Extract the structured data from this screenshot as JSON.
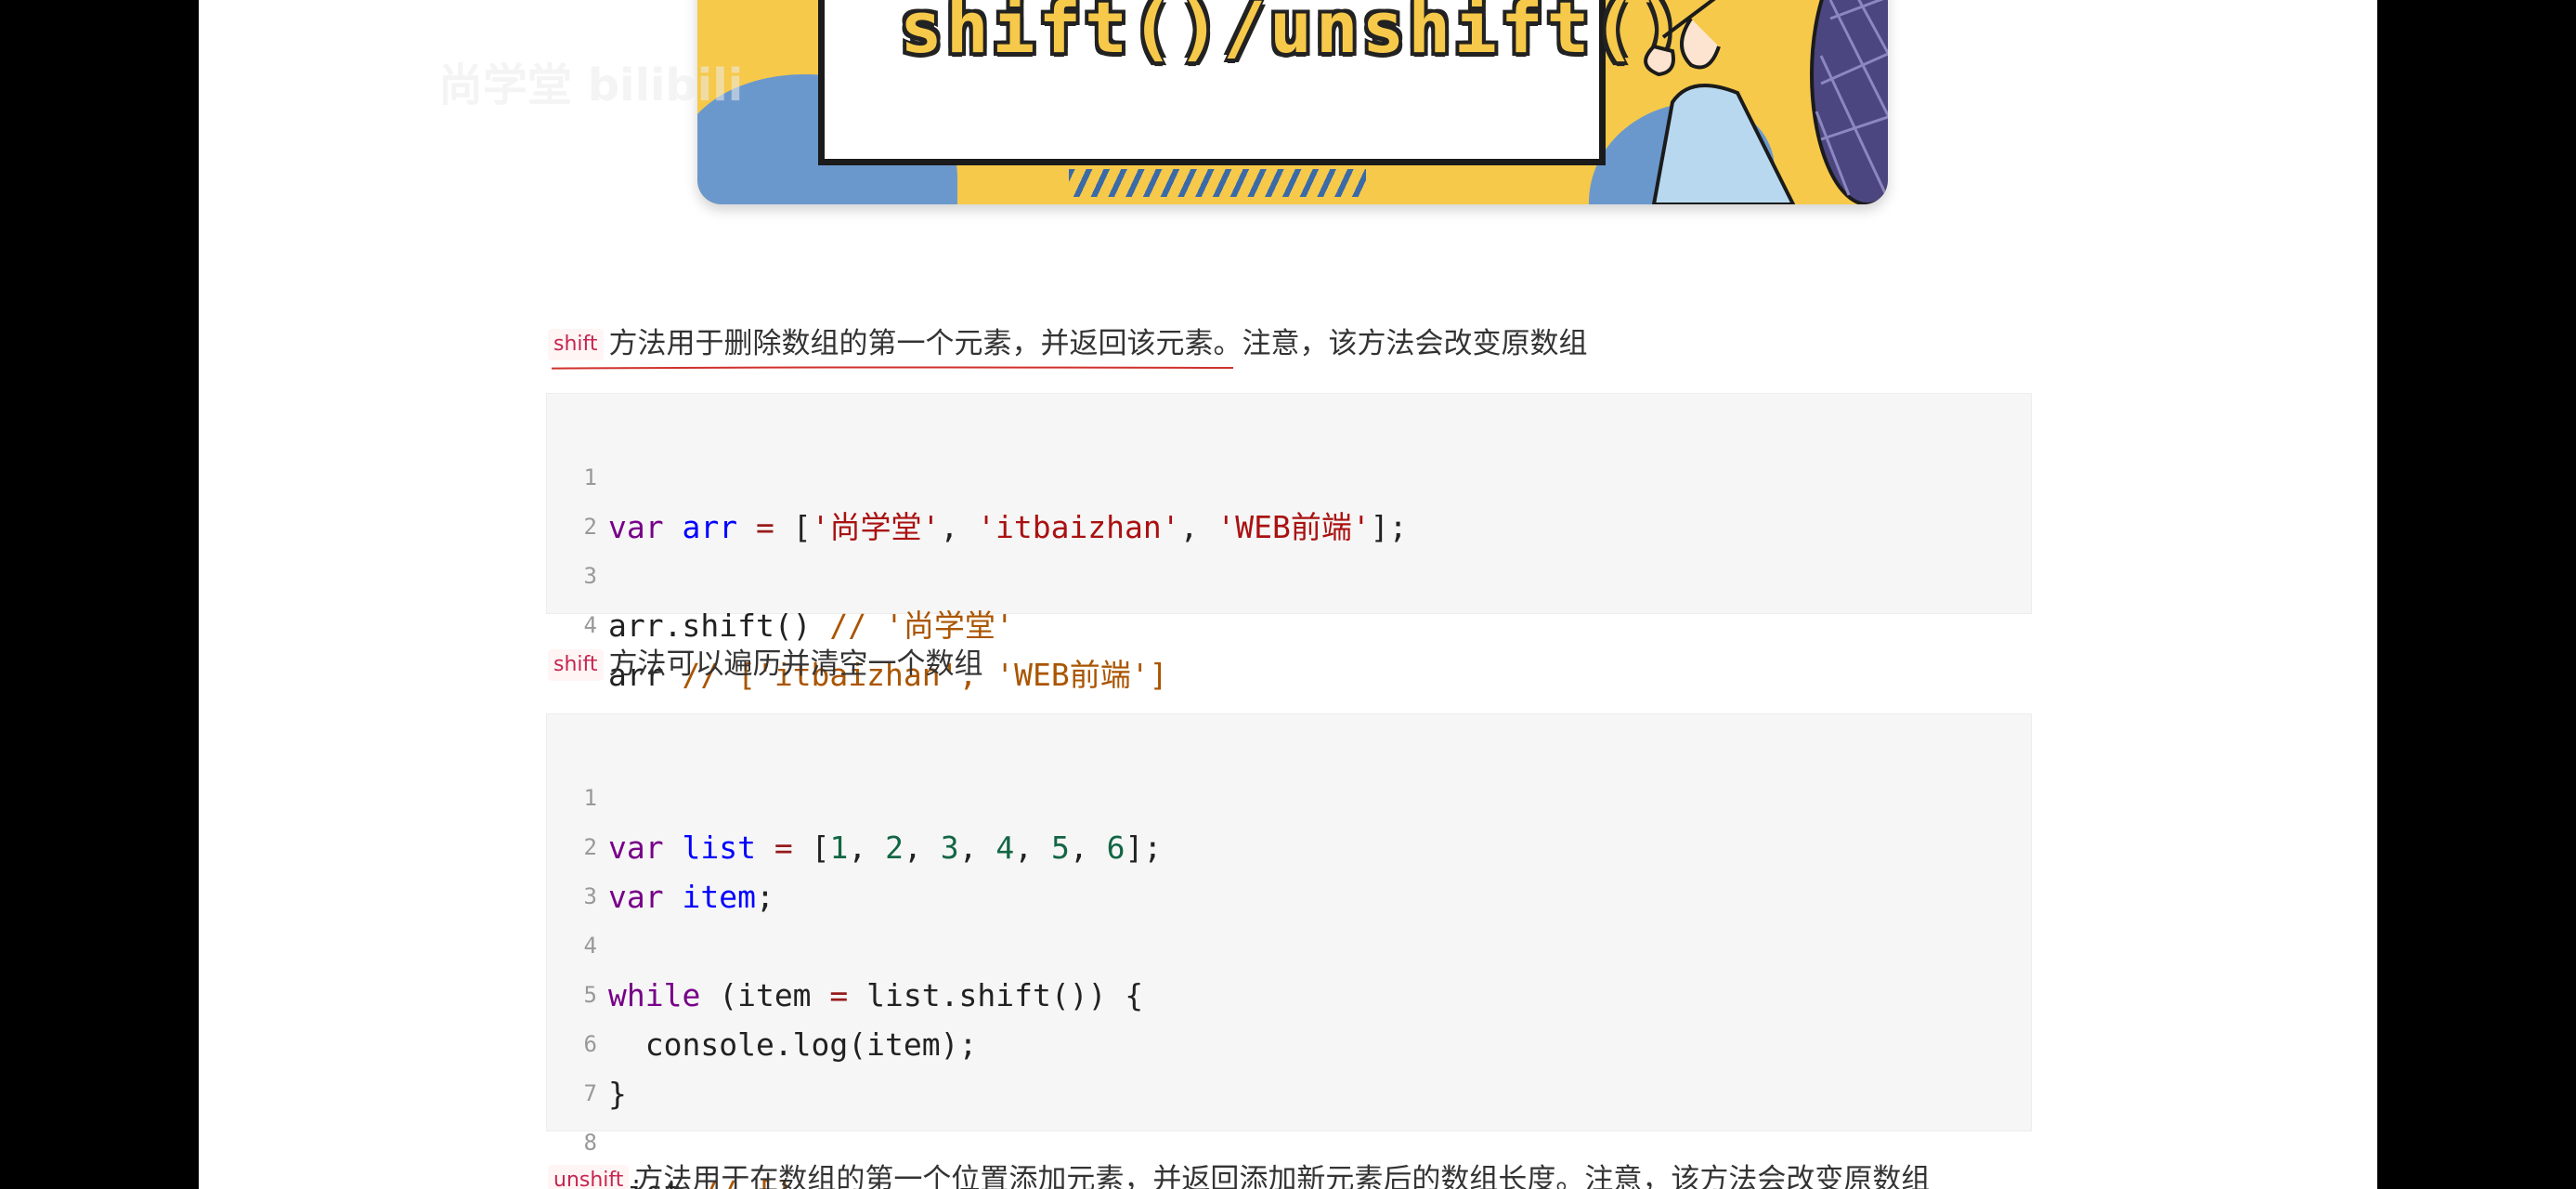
{
  "banner": {
    "title": "shift()/unshift()",
    "watermark": "尚学堂 bilibili"
  },
  "colors": {
    "banner_yellow": "#f6c94a",
    "banner_blue": "#6b98cc",
    "code_bg": "#f6f6f6",
    "tag_text": "#c7254e",
    "underline": "#d0312d"
  },
  "section1": {
    "tag": "shift",
    "text": "方法用于删除数组的第一个元素，并返回该元素。注意，该方法会改变原数组"
  },
  "code1": {
    "line_numbers": [
      "1",
      "2",
      "3",
      "4"
    ],
    "lines": [
      "var arr = ['尚学堂', 'itbaizhan', 'WEB前端'];",
      "",
      "arr.shift() // '尚学堂'",
      "arr // ['itbaizhan', 'WEB前端']"
    ]
  },
  "section2": {
    "tag": "shift",
    "text": "方法可以遍历并清空一个数组"
  },
  "code2": {
    "line_numbers": [
      "1",
      "2",
      "3",
      "4",
      "5",
      "6",
      "7",
      "8"
    ],
    "lines": [
      "var list = [1, 2, 3, 4, 5, 6];",
      "var item;",
      "",
      "while (item = list.shift()) {",
      "  console.log(item);",
      "}",
      "",
      "list // []"
    ]
  },
  "section3": {
    "tag": "unshift",
    "text": "方法用于在数组的第一个位置添加元素，并返回添加新元素后的数组长度。注意，该方法会改变原数组"
  }
}
